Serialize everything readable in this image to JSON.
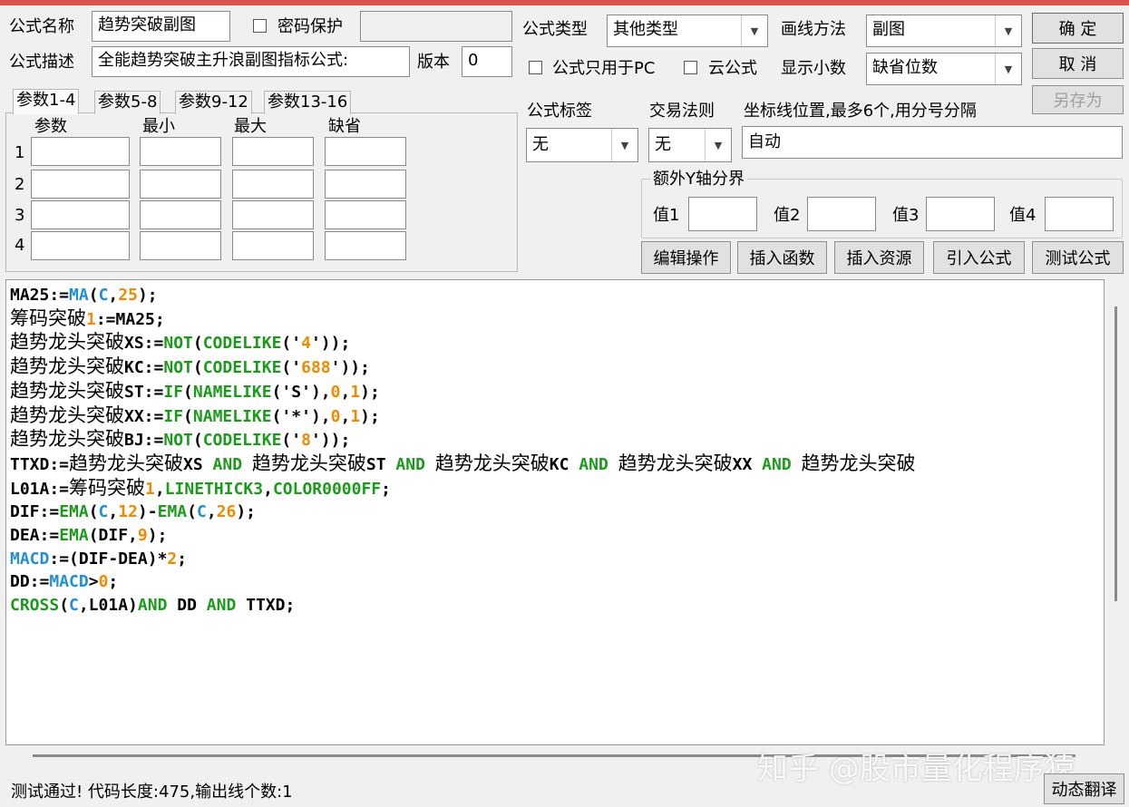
{
  "form": {
    "name_label": "公式名称",
    "name_value": "趋势突破副图",
    "password_label": "密码保护",
    "password_value": "",
    "desc_label": "公式描述",
    "desc_value": "全能趋势突破主升浪副图指标公式:",
    "version_label": "版本",
    "version_value": "0",
    "type_label": "公式类型",
    "type_value": "其他类型",
    "draw_method_label": "画线方法",
    "draw_method_value": "副图",
    "pc_only_label": "公式只用于PC",
    "cloud_label": "云公式",
    "decimal_label": "显示小数",
    "decimal_value": "缺省位数",
    "tag_label": "公式标签",
    "tag_value": "无",
    "trade_rule_label": "交易法则",
    "trade_rule_value": "无",
    "axis_label": "坐标线位置,最多6个,用分号分隔",
    "axis_value": "自动",
    "extra_y_label": "额外Y轴分界",
    "extra_y_values": [
      "值1",
      "值2",
      "值3",
      "值4"
    ]
  },
  "buttons": {
    "ok": "确 定",
    "cancel": "取 消",
    "save_as": "另存为",
    "edit_ops": "编辑操作",
    "insert_func": "插入函数",
    "insert_res": "插入资源",
    "import_formula": "引入公式",
    "test_formula": "测试公式",
    "dynamic_translate": "动态翻译"
  },
  "params": {
    "tabs": [
      "参数1-4",
      "参数5-8",
      "参数9-12",
      "参数13-16"
    ],
    "headers": [
      "参数",
      "最小",
      "最大",
      "缺省"
    ],
    "rows": [
      "1",
      "2",
      "3",
      "4"
    ]
  },
  "code_lines": [
    "MA25:=MA(C,25);",
    "筹码突破1:=MA25;",
    "趋势龙头突破XS:=NOT(CODELIKE('4'));",
    "趋势龙头突破KC:=NOT(CODELIKE('688'));",
    "趋势龙头突破ST:=IF(NAMELIKE('S'),0,1);",
    "趋势龙头突破XX:=IF(NAMELIKE('*'),0,1);",
    "趋势龙头突破BJ:=NOT(CODELIKE('8'));",
    "TTXD:=趋势龙头突破XS AND 趋势龙头突破ST AND 趋势龙头突破KC AND 趋势龙头突破XX AND 趋势龙头突破",
    "L01A:=筹码突破1,LINETHICK3,COLOR0000FF;",
    "DIF:=EMA(C,12)-EMA(C,26);",
    "DEA:=EMA(DIF,9);",
    "MACD:=(DIF-DEA)*2;",
    "DD:=MACD>0;",
    "CROSS(C,L01A)AND DD AND TTXD;"
  ],
  "status": "测试通过! 代码长度:475,输出线个数:1",
  "watermark": "知乎 @股市量化程序猿"
}
